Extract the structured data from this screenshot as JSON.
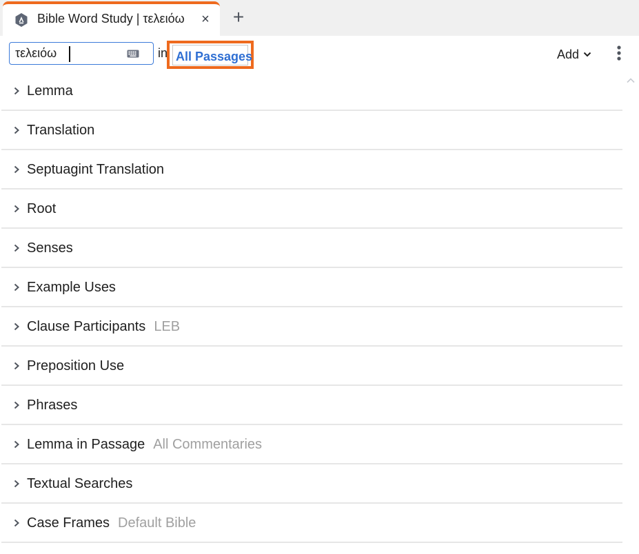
{
  "tab": {
    "title": "Bible Word Study | τελειόω",
    "close_glyph": "×",
    "add_glyph": "+"
  },
  "toolbar": {
    "search_value": "τελειόω",
    "in_label": "in",
    "passages_label": "All Passages",
    "add_label": "Add"
  },
  "colors": {
    "accent": "#ee6a1e",
    "link": "#2f6fd3",
    "muted": "#a0a0a0"
  },
  "sections": [
    {
      "label": "Lemma",
      "sub": ""
    },
    {
      "label": "Translation",
      "sub": ""
    },
    {
      "label": "Septuagint Translation",
      "sub": ""
    },
    {
      "label": "Root",
      "sub": ""
    },
    {
      "label": "Senses",
      "sub": ""
    },
    {
      "label": "Example Uses",
      "sub": ""
    },
    {
      "label": "Clause Participants",
      "sub": "LEB"
    },
    {
      "label": "Preposition Use",
      "sub": ""
    },
    {
      "label": "Phrases",
      "sub": ""
    },
    {
      "label": "Lemma in Passage",
      "sub": "All Commentaries"
    },
    {
      "label": "Textual Searches",
      "sub": ""
    },
    {
      "label": "Case Frames",
      "sub": "Default Bible"
    }
  ]
}
